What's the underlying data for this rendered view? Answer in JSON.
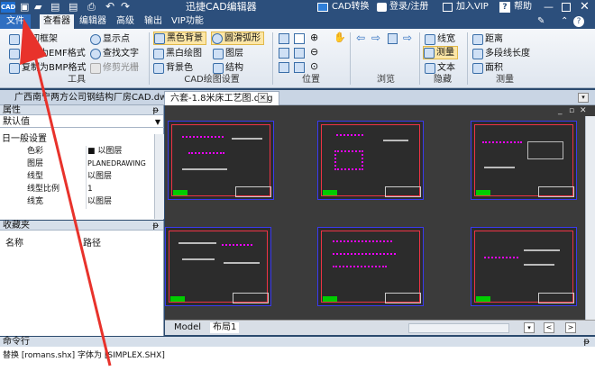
{
  "title_bar": {
    "logo": "CAD",
    "title": "迅捷CAD编辑器",
    "convert_label": "CAD转换",
    "login_label": "登录/注册",
    "vip_label": "加入VIP",
    "help_label": "帮助",
    "help_badge": "?"
  },
  "menu": {
    "items": [
      "文件",
      "查看器",
      "编辑器",
      "高级",
      "输出",
      "VIP功能"
    ]
  },
  "ribbon": {
    "tools_group": {
      "label": "工具",
      "items": [
        "剪切框架",
        "复制为EMF格式",
        "复制为BMP格式",
        "显示点",
        "查找文字",
        "修剪光栅"
      ]
    },
    "draw_settings_group": {
      "label": "CAD绘图设置",
      "items": [
        "黑色背景",
        "黑白绘图",
        "背景色",
        "圆滑弧形",
        "图层",
        "结构"
      ]
    },
    "position_group": {
      "label": "位置"
    },
    "browse_group": {
      "label": "浏览"
    },
    "hide_group": {
      "label": "隐藏",
      "items": [
        "线宽",
        "测量",
        "文本"
      ]
    },
    "measure_group": {
      "label": "测量",
      "items": [
        "距离",
        "多段线长度",
        "面积"
      ]
    }
  },
  "doc_tabs": {
    "tabs": [
      "广西南宁两方公司钢结构厂房CAD.dwg",
      "六套-1.8米床工艺图.dwg"
    ]
  },
  "properties": {
    "header": "属性",
    "pin": "ᵽ",
    "selector": "默认值",
    "section": "日一般设置",
    "rows": [
      {
        "key": "色彩",
        "value": "■ 以图层"
      },
      {
        "key": "图层",
        "value": "PLANEDRAWING"
      },
      {
        "key": "线型",
        "value": "以图层"
      },
      {
        "key": "线型比例",
        "value": "1"
      },
      {
        "key": "线宽",
        "value": "以图层"
      }
    ]
  },
  "favorites": {
    "header": "收藏夹",
    "pin": "ᵽ",
    "col_name": "名称",
    "col_path": "路径"
  },
  "model_tabs": {
    "tabs": [
      "Model",
      "布局1"
    ]
  },
  "command": {
    "header": "命令行",
    "pin": "ᵽ",
    "text": "替换 [romans.shx] 字体为 [SIMPLEX.SHX]"
  },
  "colors": {
    "titlebar": "#2c4f7c",
    "accent": "#2f6fc1",
    "canvas": "#3b3b3b",
    "frame_blue": "#3a3af0",
    "frame_red": "#e33344",
    "arrow_red": "#e8322b"
  }
}
